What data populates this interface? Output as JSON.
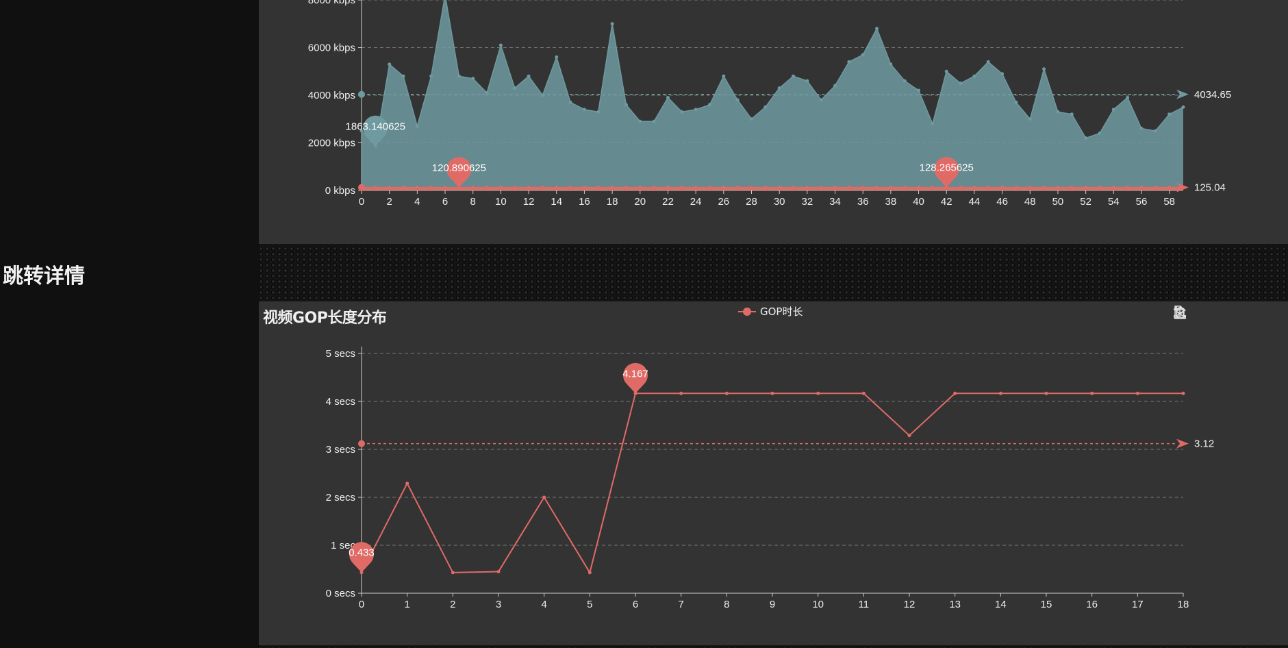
{
  "page": {
    "jump_label": "跳转详情"
  },
  "colors": {
    "bitrate": "#6f9aa0",
    "gop": "#e06b66",
    "panel": "#333333"
  },
  "bitrate_chart": {
    "toolbox": [
      "data-view-icon",
      "refresh-icon",
      "download-icon",
      "crop-icon",
      "reset-icon"
    ],
    "chart_data": {
      "type": "area",
      "title": "",
      "y_tick_labels": [
        "0 kbps",
        "2000 kbps",
        "4000 kbps",
        "6000 kbps",
        "8000 kbps"
      ],
      "ylim": [
        0,
        8000
      ],
      "x_tick_labels": [
        "0",
        "2",
        "4",
        "6",
        "8",
        "10",
        "12",
        "14",
        "16",
        "18",
        "20",
        "22",
        "24",
        "26",
        "28",
        "30",
        "32",
        "34",
        "36",
        "38",
        "40",
        "42",
        "44",
        "46",
        "48",
        "50",
        "52",
        "54",
        "56",
        "58"
      ],
      "grid": true,
      "series": [
        {
          "x": [
            0,
            1,
            2,
            3,
            4,
            5,
            6,
            7,
            8,
            9,
            10,
            11,
            12,
            13,
            14,
            15,
            16,
            17,
            18,
            19,
            20,
            21,
            22,
            23,
            24,
            25,
            26,
            27,
            28,
            29,
            30,
            31,
            32,
            33,
            34,
            35,
            36,
            37,
            38,
            39,
            40,
            41,
            42,
            43,
            44,
            45,
            46,
            47,
            48,
            49,
            50,
            51,
            52,
            53,
            54,
            55,
            56,
            57,
            58,
            59
          ],
          "values": [
            2500,
            1863.140625,
            5300,
            4800,
            2700,
            4800,
            8200,
            4800,
            4700,
            4100,
            6100,
            4300,
            4800,
            4000,
            5600,
            3700,
            3400,
            3300,
            7000,
            3600,
            2900,
            2900,
            3900,
            3300,
            3400,
            3600,
            4800,
            3800,
            3000,
            3500,
            4300,
            4800,
            4600,
            3800,
            4400,
            5400,
            5700,
            6800,
            5300,
            4600,
            4200,
            2800,
            5000,
            4500,
            4800,
            5400,
            4900,
            3700,
            3000,
            5100,
            3300,
            3200,
            2200,
            2400,
            3400,
            3900,
            2600,
            2500,
            3200,
            3500
          ],
          "markpoints": [
            {
              "x": 1,
              "value": "1863.140625"
            }
          ],
          "markline": {
            "value": 4034.65,
            "label": "4034.65"
          }
        },
        {
          "x": [
            0,
            1,
            2,
            3,
            4,
            5,
            6,
            7,
            8,
            9,
            10,
            11,
            12,
            13,
            14,
            15,
            16,
            17,
            18,
            19,
            20,
            21,
            22,
            23,
            24,
            25,
            26,
            27,
            28,
            29,
            30,
            31,
            32,
            33,
            34,
            35,
            36,
            37,
            38,
            39,
            40,
            41,
            42,
            43,
            44,
            45,
            46,
            47,
            48,
            49,
            50,
            51,
            52,
            53,
            54,
            55,
            56,
            57,
            58,
            59
          ],
          "values": [
            125,
            125,
            125,
            125,
            125,
            125,
            125,
            120.890625,
            125,
            125,
            125,
            125,
            125,
            125,
            125,
            125,
            125,
            125,
            125,
            125,
            125,
            125,
            125,
            125,
            125,
            125,
            125,
            125,
            125,
            125,
            125,
            125,
            125,
            125,
            125,
            125,
            125,
            125,
            125,
            125,
            125,
            125,
            128.265625,
            125,
            125,
            125,
            125,
            125,
            125,
            125,
            125,
            125,
            125,
            125,
            125,
            125,
            125,
            125,
            125,
            125
          ],
          "markpoints": [
            {
              "x": 7,
              "value": "120.890625"
            },
            {
              "x": 42,
              "value": "128.265625"
            }
          ],
          "markline": {
            "value": 125.04,
            "label": "125.04"
          }
        }
      ]
    }
  },
  "gop_chart": {
    "title": "视频GOP长度分布",
    "legend_label": "GOP时长",
    "toolbox": [
      "data-view-icon",
      "refresh-icon",
      "download-icon",
      "crop-icon",
      "reset-icon"
    ],
    "chart_data": {
      "type": "line",
      "title": "视频GOP长度分布",
      "x": [
        0,
        1,
        2,
        3,
        4,
        5,
        6,
        7,
        8,
        9,
        10,
        11,
        12,
        13,
        14,
        15,
        16,
        17,
        18
      ],
      "x_tick_labels": [
        "0",
        "1",
        "2",
        "3",
        "4",
        "5",
        "6",
        "7",
        "8",
        "9",
        "10",
        "11",
        "12",
        "13",
        "14",
        "15",
        "16",
        "17",
        "18"
      ],
      "y_tick_labels": [
        "0 secs",
        "1 sec",
        "2 secs",
        "3 secs",
        "4 secs",
        "5 secs"
      ],
      "ylim": [
        0,
        5
      ],
      "grid": true,
      "series": [
        {
          "name": "GOP时长",
          "values": [
            0.433,
            2.29,
            0.43,
            0.45,
            2.0,
            0.43,
            4.167,
            4.167,
            4.167,
            4.167,
            4.167,
            4.167,
            3.29,
            4.167,
            4.167,
            4.167,
            4.167,
            4.167,
            4.167
          ],
          "markpoints": [
            {
              "x": 0,
              "value": "0.433"
            },
            {
              "x": 6,
              "value": "4.167"
            }
          ],
          "markline": {
            "value": 3.12,
            "label": "3.12"
          }
        }
      ]
    }
  }
}
